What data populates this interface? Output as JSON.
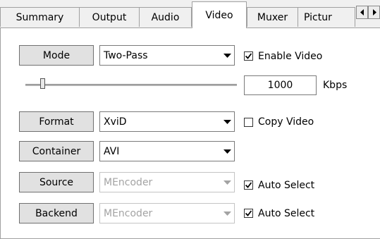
{
  "tabs": [
    {
      "label": "Summary",
      "active": false
    },
    {
      "label": "Output",
      "active": false
    },
    {
      "label": "Audio",
      "active": false
    },
    {
      "label": "Video",
      "active": true
    },
    {
      "label": "Muxer",
      "active": false
    },
    {
      "label": "Pictur",
      "active": false
    }
  ],
  "tab_scroll": {
    "left_icon": "arrow-left-icon",
    "right_icon": "arrow-right-icon"
  },
  "video": {
    "mode": {
      "button": "Mode",
      "value": "Two-Pass"
    },
    "enable_video": {
      "label": "Enable Video",
      "checked": true
    },
    "bitrate": {
      "value": "1000",
      "unit": "Kbps",
      "slider_level": 0.07
    },
    "format": {
      "button": "Format",
      "value": "XviD"
    },
    "copy_video": {
      "label": "Copy Video",
      "checked": false
    },
    "container": {
      "button": "Container",
      "value": "AVI"
    },
    "source": {
      "button": "Source",
      "value": "MEncoder",
      "disabled": true
    },
    "source_auto": {
      "label": "Auto Select",
      "checked": true
    },
    "backend": {
      "button": "Backend",
      "value": "MEncoder",
      "disabled": true
    },
    "backend_auto": {
      "label": "Auto Select",
      "checked": true
    }
  }
}
